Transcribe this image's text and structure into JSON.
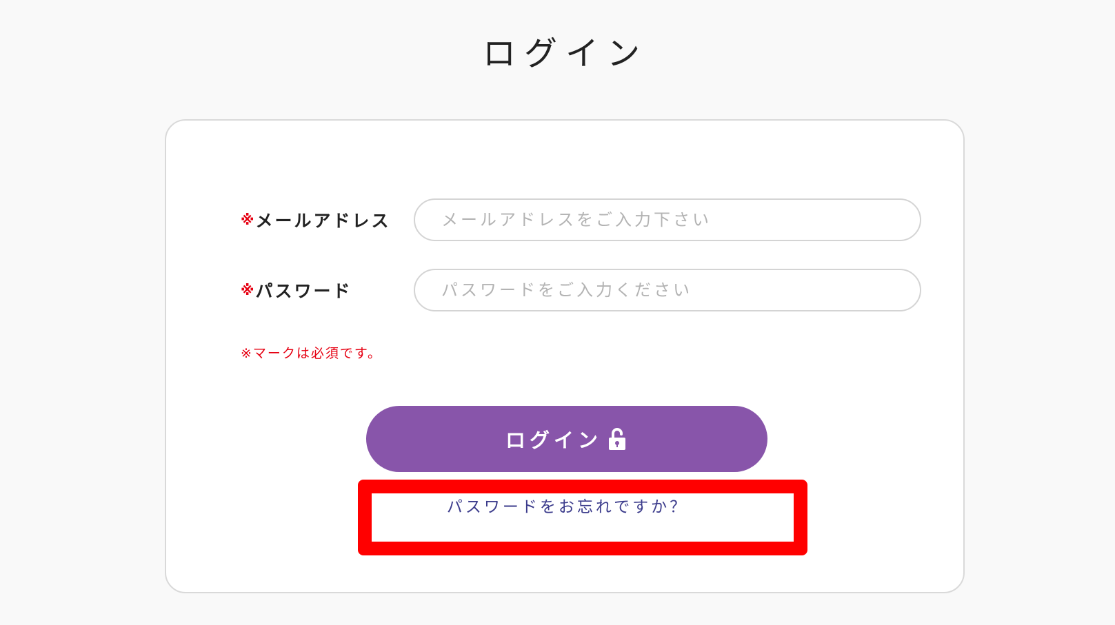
{
  "page": {
    "title": "ログイン"
  },
  "form": {
    "required_mark": "※",
    "email": {
      "label": "メールアドレス",
      "placeholder": "メールアドレスをご入力下さい",
      "value": ""
    },
    "password": {
      "label": "パスワード",
      "placeholder": "パスワードをご入力ください",
      "value": ""
    },
    "required_note": "※マークは必須です。",
    "login_button": {
      "label": "ログイン",
      "icon": "unlock-icon"
    },
    "forgot_password_link": "パスワードをお忘れですか？"
  },
  "colors": {
    "background": "#f9f9f9",
    "card_background": "#ffffff",
    "accent": "#8855aa",
    "required": "#e60012",
    "link": "#3c3c8c",
    "highlight": "#ff0000"
  }
}
